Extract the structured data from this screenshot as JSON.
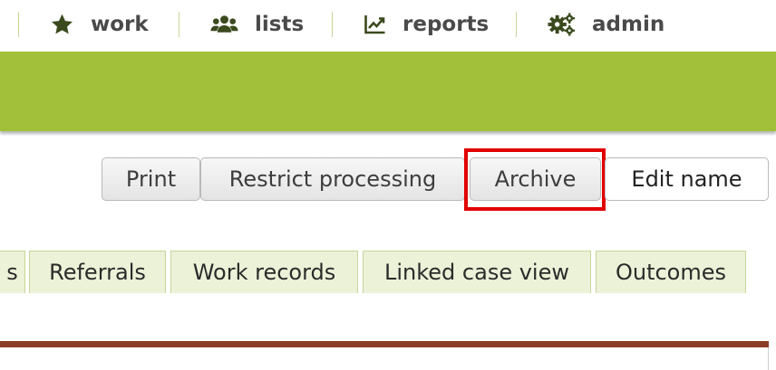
{
  "nav": {
    "items": [
      {
        "label": "work",
        "icon": "star-icon"
      },
      {
        "label": "lists",
        "icon": "users-icon"
      },
      {
        "label": "reports",
        "icon": "line-chart-icon"
      },
      {
        "label": "admin",
        "icon": "gears-icon"
      }
    ]
  },
  "actions": {
    "print": "Print",
    "restrict": "Restrict processing",
    "archive": "Archive",
    "edit_name": "Edit name"
  },
  "tabs": [
    "s",
    "Referrals",
    "Work records",
    "Linked case view",
    "Outcomes"
  ],
  "colors": {
    "brand_green": "#a2c03a",
    "nav_text": "#4a4a4a",
    "icon_green": "#3b4a1e",
    "tab_bg": "#ecf2d8",
    "rule_brown": "#8b3e25",
    "highlight": "#e10000"
  }
}
